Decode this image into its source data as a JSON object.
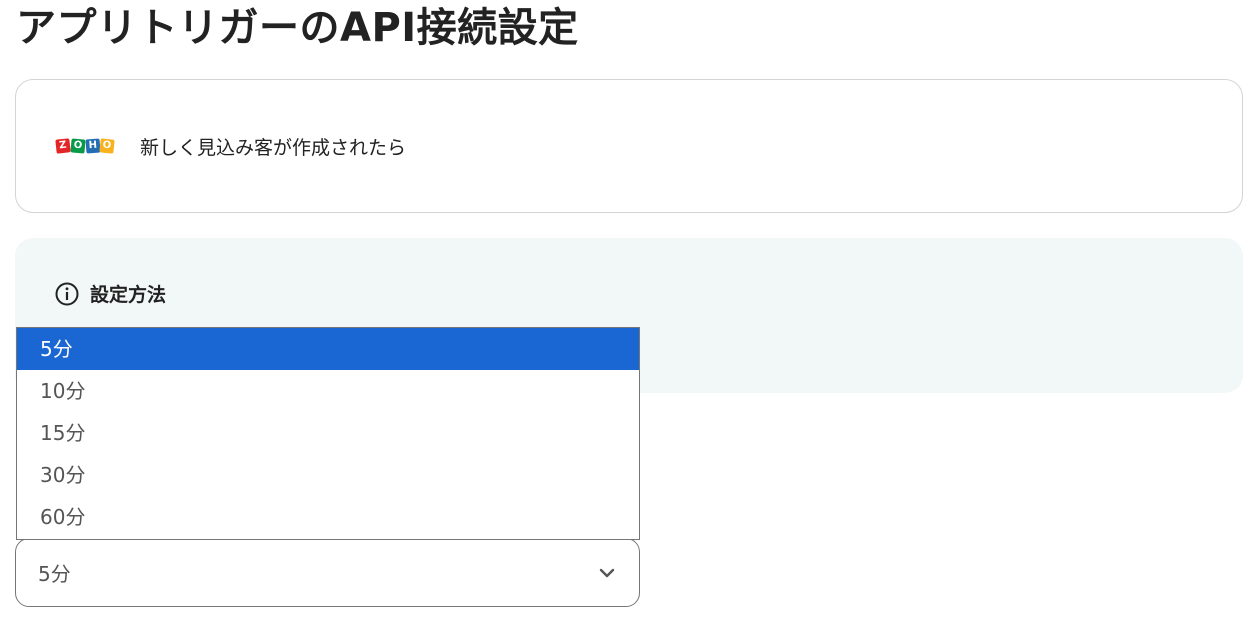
{
  "page": {
    "title": "アプリトリガーのAPI接続設定"
  },
  "trigger": {
    "app_logo": {
      "icon": "zoho-logo",
      "letters": [
        "Z",
        "O",
        "H",
        "O"
      ],
      "colors": [
        "#e42527",
        "#089949",
        "#226db4",
        "#f9b21d"
      ]
    },
    "label": "新しく見込み客が作成されたら"
  },
  "info": {
    "icon": "info-circle-icon",
    "title": "設定方法"
  },
  "interval_select": {
    "value": "5分",
    "options": [
      {
        "label": "5分",
        "selected": true
      },
      {
        "label": "10分",
        "selected": false
      },
      {
        "label": "15分",
        "selected": false
      },
      {
        "label": "30分",
        "selected": false
      },
      {
        "label": "60分",
        "selected": false
      }
    ],
    "chevron_icon": "chevron-down-icon",
    "highlight_color": "#1a66d2"
  }
}
